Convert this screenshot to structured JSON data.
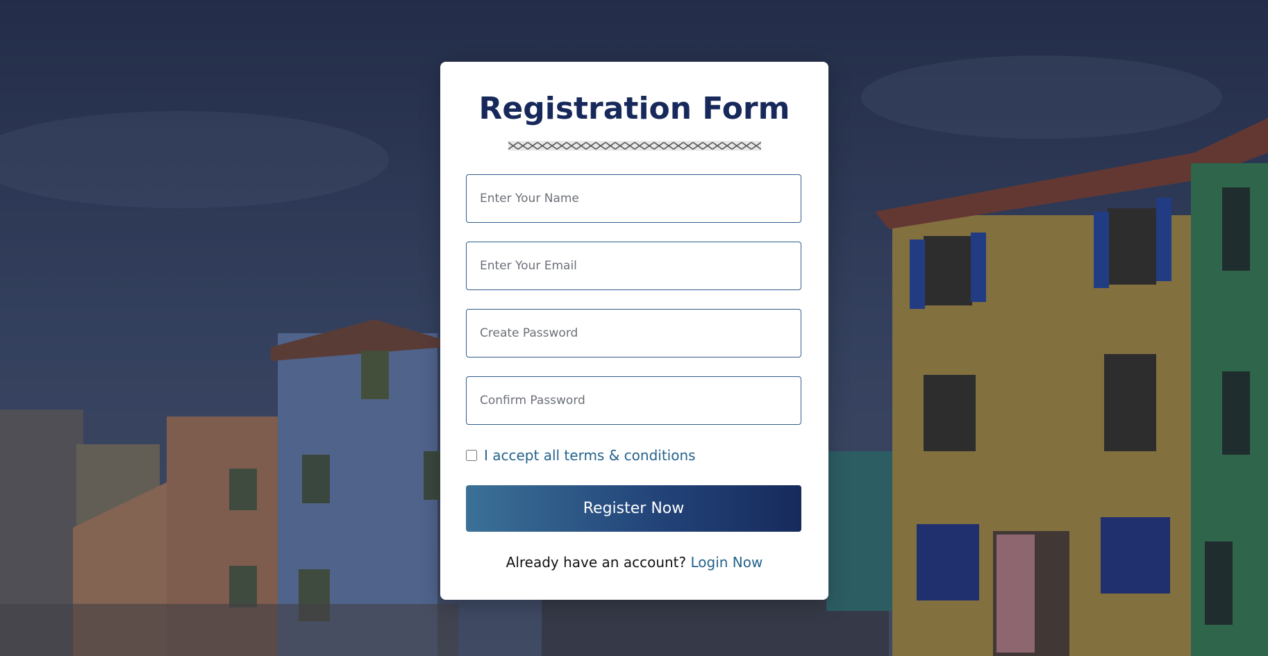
{
  "form": {
    "title": "Registration Form",
    "name_placeholder": "Enter Your Name",
    "email_placeholder": "Enter Your Email",
    "password_placeholder": "Create Password",
    "confirm_placeholder": "Confirm Password",
    "terms_label": "I accept all terms & conditions",
    "register_label": "Register Now",
    "account_prompt": "Already have an account?",
    "login_label": "Login Now"
  },
  "colors": {
    "title": "#17295b",
    "accent": "#24628b",
    "button_start": "#3b7197",
    "button_end": "#172a5c",
    "field_border": "#2d5b8a"
  }
}
